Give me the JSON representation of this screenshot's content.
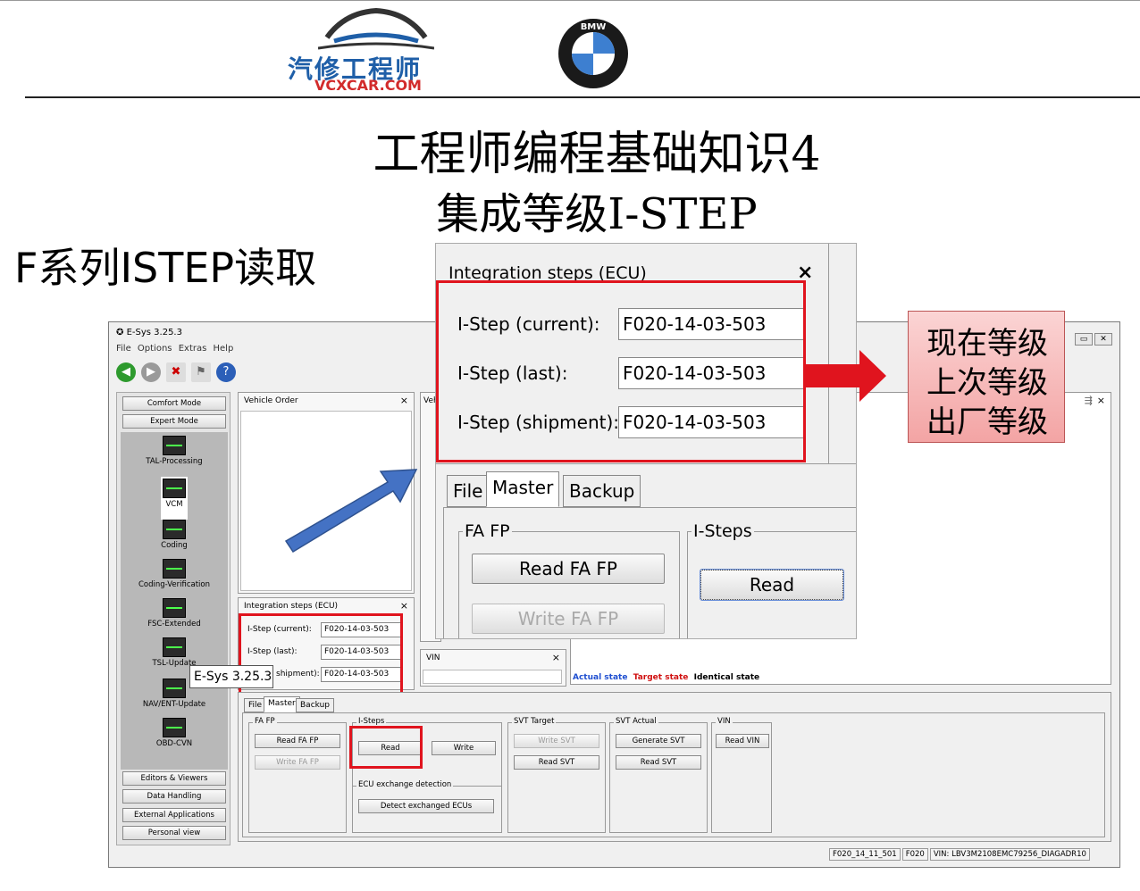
{
  "brand": {
    "name": "汽修工程师",
    "url": "VCXCAR.COM",
    "bmw_logo_letters": "BMW"
  },
  "titles": {
    "line1": "工程师编程基础知识4",
    "line2": "集成等级I-STEP",
    "section": "F系列ISTEP读取"
  },
  "window": {
    "title": "E-Sys 3.25.3",
    "menu": [
      "File",
      "Options",
      "Extras",
      "Help"
    ]
  },
  "left_panel": {
    "top_buttons": [
      "Comfort Mode",
      "Expert Mode"
    ],
    "modes": [
      "TAL-Processing",
      "VCM",
      "Coding",
      "Coding-Verification",
      "FSC-Extended",
      "TSL-Update",
      "NAV/ENT-Update",
      "OBD-CVN"
    ],
    "bottom_buttons": [
      "Editors & Viewers",
      "Data Handling",
      "External Applications",
      "Personal view"
    ]
  },
  "vehicle_order": {
    "title": "Vehicle Order",
    "tab_partial": "Veh"
  },
  "integration_steps": {
    "title": "Integration steps (ECU)",
    "current_label": "I-Step (current):",
    "last_label": "I-Step (last):",
    "shipment_label": "I-Step (shipment):",
    "shipment_label_partial": "shipment):",
    "current_value": "F020-14-03-503",
    "last_value": "F020-14-03-503",
    "shipment_value": "F020-14-03-503"
  },
  "vin_panel": {
    "title": "VIN"
  },
  "legend": {
    "actual": "Actual state",
    "target": "Target state",
    "identical": "Identical state"
  },
  "tabs": [
    "File",
    "Master",
    "Backup"
  ],
  "groups": {
    "fa_fp": {
      "label": "FA FP",
      "read": "Read FA FP",
      "write": "Write FA FP"
    },
    "isteps": {
      "label": "I-Steps",
      "read": "Read",
      "write": "Write"
    },
    "ecu_exchange": {
      "label": "ECU exchange detection",
      "detect": "Detect exchanged ECUs"
    },
    "svt_target": {
      "label": "SVT Target",
      "write": "Write SVT",
      "read": "Read SVT"
    },
    "svt_actual": {
      "label": "SVT Actual",
      "generate": "Generate SVT",
      "read": "Read SVT"
    },
    "vin": {
      "label": "VIN",
      "read": "Read VIN"
    }
  },
  "status_bar": [
    "F020_14_11_501",
    "F020",
    "VIN: LBV3M2108EMC79256_DIAGADR10"
  ],
  "tooltip": "E-Sys 3.25.3",
  "callout": [
    "现在等级",
    "上次等级",
    "出厂等级"
  ],
  "colors": {
    "highlight_red": "#e0141e",
    "arrow_blue": "#4472c4",
    "legend_blue": "#1f4fd0",
    "legend_red": "#d01010"
  }
}
